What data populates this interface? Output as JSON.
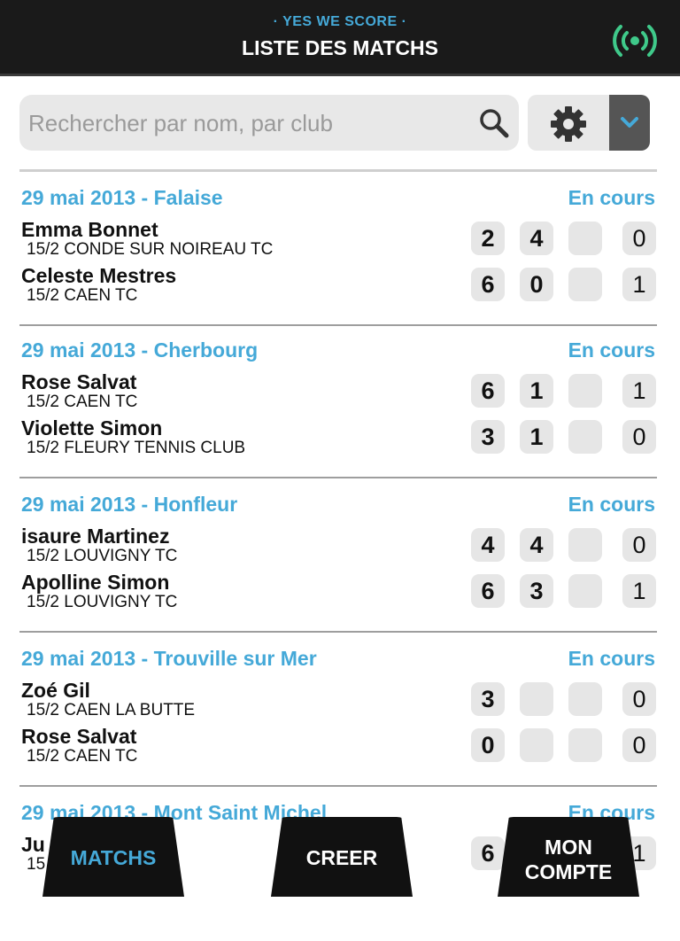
{
  "header": {
    "brand": "· YES WE SCORE ·",
    "title": "LISTE DES MATCHS",
    "live_icon": "broadcast-icon",
    "accent": "#45a9d8",
    "live_color": "#3fc98a"
  },
  "search": {
    "placeholder": "Rechercher par nom, par club",
    "icon": "search-icon"
  },
  "settings": {
    "icon": "gear-icon",
    "dropdown_icon": "chevron-down-icon"
  },
  "matches": [
    {
      "header": "29 mai 2013 - Falaise",
      "status": "En cours",
      "p1": {
        "name": "Emma Bonnet",
        "club": "15/2 CONDE SUR NOIREAU TC",
        "sets": [
          "2",
          "4",
          ""
        ],
        "total": "0"
      },
      "p2": {
        "name": "Celeste Mestres",
        "club": "15/2 CAEN TC",
        "sets": [
          "6",
          "0",
          ""
        ],
        "total": "1"
      }
    },
    {
      "header": "29 mai 2013 - Cherbourg",
      "status": "En cours",
      "p1": {
        "name": "Rose Salvat",
        "club": "15/2 CAEN TC",
        "sets": [
          "6",
          "1",
          ""
        ],
        "total": "1"
      },
      "p2": {
        "name": "Violette Simon",
        "club": "15/2 FLEURY TENNIS CLUB",
        "sets": [
          "3",
          "1",
          ""
        ],
        "total": "0"
      }
    },
    {
      "header": "29 mai 2013 - Honfleur",
      "status": "En cours",
      "p1": {
        "name": "isaure Martinez",
        "club": "15/2 LOUVIGNY TC",
        "sets": [
          "4",
          "4",
          ""
        ],
        "total": "0"
      },
      "p2": {
        "name": "Apolline Simon",
        "club": "15/2 LOUVIGNY TC",
        "sets": [
          "6",
          "3",
          ""
        ],
        "total": "1"
      }
    },
    {
      "header": "29 mai 2013 - Trouville sur Mer",
      "status": "En cours",
      "p1": {
        "name": "Zoé Gil",
        "club": "15/2 CAEN LA BUTTE",
        "sets": [
          "3",
          "",
          ""
        ],
        "total": "0"
      },
      "p2": {
        "name": "Rose Salvat",
        "club": "15/2 CAEN TC",
        "sets": [
          "0",
          "",
          ""
        ],
        "total": "0"
      }
    },
    {
      "header": "29 mai 2013 - Mont Saint Michel",
      "status": "En cours",
      "p1": {
        "name": "Ju",
        "club": "15",
        "sets": [
          "6",
          "",
          ""
        ],
        "total": "1"
      },
      "p2": {
        "name": "",
        "club": "",
        "sets": [
          "",
          "",
          ""
        ],
        "total": ""
      }
    }
  ],
  "nav": {
    "matchs": "MATCHS",
    "creer": "CREER",
    "compte_line1": "MON",
    "compte_line2": "COMPTE"
  }
}
